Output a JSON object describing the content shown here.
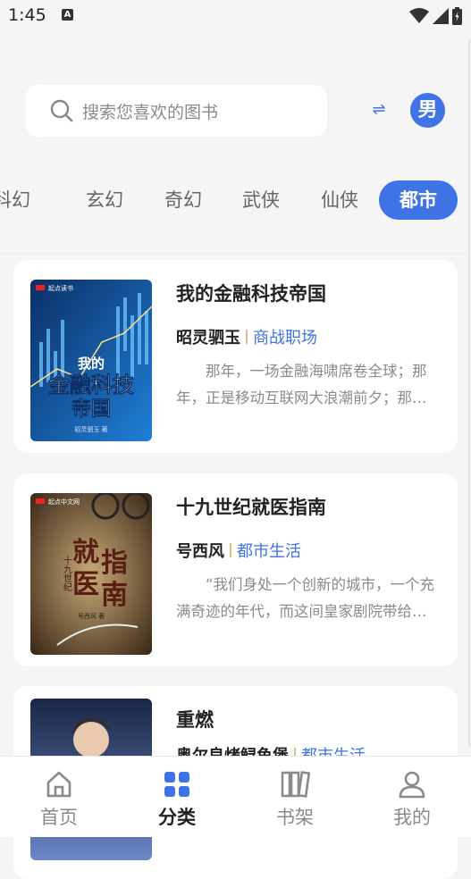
{
  "status_bar": {
    "time": "1:45",
    "a_badge": "A"
  },
  "search": {
    "placeholder": "搜索您喜欢的图书",
    "swap_icon": "⇌",
    "gender_label": "男"
  },
  "category_tabs": [
    {
      "label": "科幻",
      "active": false
    },
    {
      "label": "玄幻",
      "active": false
    },
    {
      "label": "奇幻",
      "active": false
    },
    {
      "label": "武侠",
      "active": false
    },
    {
      "label": "仙侠",
      "active": false
    },
    {
      "label": "都市",
      "active": true
    }
  ],
  "books": [
    {
      "title": "我的金融科技帝国",
      "author": "昭灵驷玉",
      "genre": "商战职场",
      "description": "那年，一场金融海啸席卷全球；那年，正是移动互联网大浪潮前夕；那年，他重生了……",
      "cover": {
        "publisher": "起点读书",
        "title_lines": [
          "我的",
          "金融科技",
          "帝国"
        ],
        "author_mark": "昭灵驷玉 著",
        "colors": [
          "#0b3a78",
          "#1d76c9"
        ]
      }
    },
    {
      "title": "十九世纪就医指南",
      "author": "号西风",
      "genre": "都市生活",
      "description": "“我们身处一个创新的城市，一个充满奇迹的年代，而这间皇家剧院带给您的将是一场……",
      "cover": {
        "publisher": "起点中文网",
        "title_lines": [
          "就",
          "指",
          "医",
          "南"
        ],
        "side_text": "十九世纪",
        "author_mark": "号西风 著",
        "colors": [
          "#3b2a1c",
          "#b89a6a"
        ]
      }
    },
    {
      "title": "重燃",
      "author": "奥尔良烤鲟鱼堡",
      "genre": "都市生活",
      "description": "",
      "cover": {
        "colors": [
          "#1d2b4a",
          "#5a76b6"
        ]
      }
    }
  ],
  "bottom_nav": [
    {
      "label": "首页",
      "icon": "home-icon",
      "active": false
    },
    {
      "label": "分类",
      "icon": "category-grid-icon",
      "active": true
    },
    {
      "label": "书架",
      "icon": "bookshelf-icon",
      "active": false
    },
    {
      "label": "我的",
      "icon": "profile-icon",
      "active": false
    }
  ],
  "colors": {
    "accent": "#3f73e6",
    "background": "#f5f5f5",
    "card": "#ffffff",
    "muted": "#8a8a8a"
  }
}
